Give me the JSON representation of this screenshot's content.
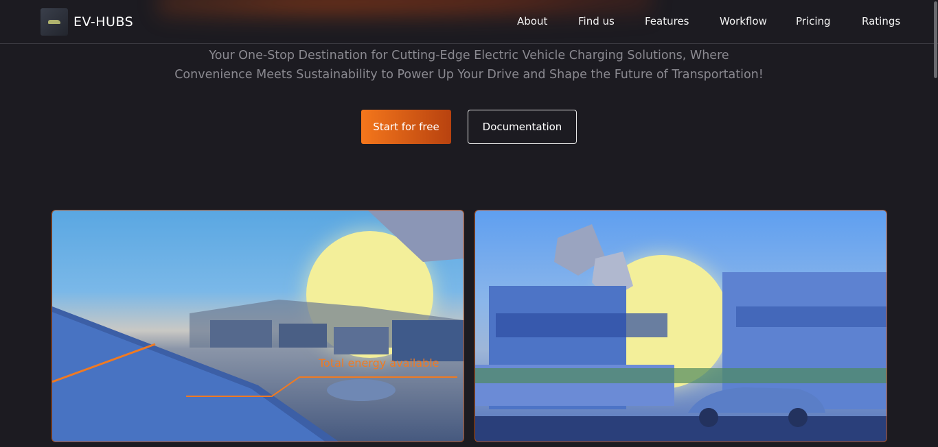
{
  "header": {
    "brand": "EV-HUBS",
    "nav": [
      "About",
      "Find us",
      "Features",
      "Workflow",
      "Pricing",
      "Ratings"
    ]
  },
  "hero": {
    "tagline_line1": "Your One-Stop Destination for Cutting-Edge Electric Vehicle Charging Solutions, Where",
    "tagline_line2": "Convenience Meets Sustainability to Power Up Your Drive and Shape the Future of Transportation!",
    "primary_button": "Start for free",
    "secondary_button": "Documentation"
  },
  "cards": {
    "left_overlay_text": "Total energy available"
  },
  "colors": {
    "background": "#1c1b21",
    "accent": "#f4771c",
    "accent_dark": "#b8420f",
    "card_border": "#b4521e"
  }
}
